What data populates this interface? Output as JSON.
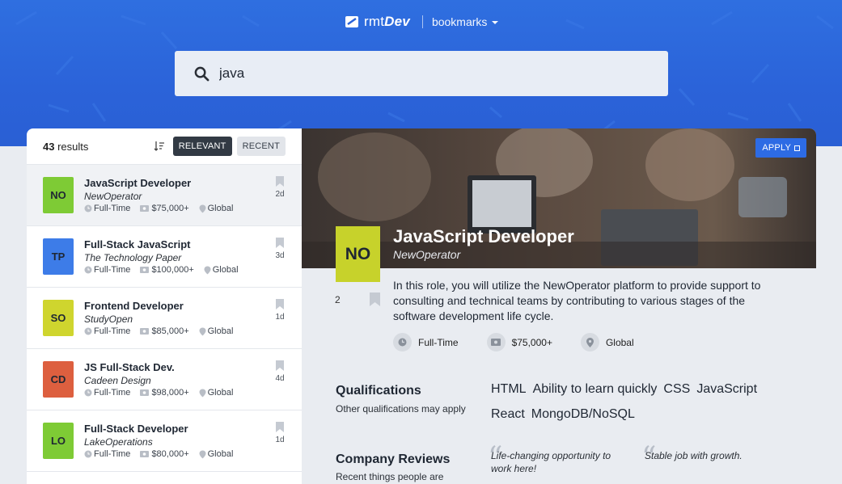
{
  "header": {
    "brand_plain": "rmt",
    "brand_bold": "Dev",
    "bookmarks_label": "bookmarks",
    "colors": {
      "band": "#2b63d9",
      "accent": "#2d6be4"
    }
  },
  "search": {
    "value": "java",
    "placeholder": ""
  },
  "results": {
    "count": "43",
    "count_label": "results",
    "sort_relevant": "RELEVANT",
    "sort_recent": "RECENT",
    "jobs": [
      {
        "badge": "NO",
        "badge_color": "#7ecb35",
        "title": "JavaScript Developer",
        "company": "NewOperator",
        "type": "Full-Time",
        "salary": "$75,000+",
        "location": "Global",
        "age": "2d"
      },
      {
        "badge": "TP",
        "badge_color": "#3d7ce8",
        "title": "Full-Stack JavaScript",
        "company": "The Technology Paper",
        "type": "Full-Time",
        "salary": "$100,000+",
        "location": "Global",
        "age": "3d"
      },
      {
        "badge": "SO",
        "badge_color": "#cfd52e",
        "title": "Frontend Developer",
        "company": "StudyOpen",
        "type": "Full-Time",
        "salary": "$85,000+",
        "location": "Global",
        "age": "1d"
      },
      {
        "badge": "CD",
        "badge_color": "#dd5f3f",
        "title": "JS Full-Stack Dev.",
        "company": "Cadeen Design",
        "type": "Full-Time",
        "salary": "$98,000+",
        "location": "Global",
        "age": "4d"
      },
      {
        "badge": "LO",
        "badge_color": "#7ecb35",
        "title": "Full-Stack Developer",
        "company": "LakeOperations",
        "type": "Full-Time",
        "salary": "$80,000+",
        "location": "Global",
        "age": "1d"
      }
    ]
  },
  "detail": {
    "apply_label": "APPLY",
    "badge": "NO",
    "title": "JavaScript Developer",
    "company": "NewOperator",
    "days": "2",
    "description": "In this role, you will utilize the NewOperator platform to provide support to consulting and technical teams by contributing to various stages of the software development life cycle.",
    "type": "Full-Time",
    "salary": "$75,000+",
    "location": "Global",
    "qualifications_title": "Qualifications",
    "qualifications_sub": "Other qualifications may apply",
    "qualifications": [
      "HTML",
      "Ability to learn quickly",
      "CSS",
      "JavaScript",
      "React",
      "MongoDB/NoSQL"
    ],
    "reviews_title": "Company Reviews",
    "reviews_sub": "Recent things people are",
    "reviews": [
      "Life-changing opportunity to work here!",
      "Stable job with growth."
    ]
  }
}
